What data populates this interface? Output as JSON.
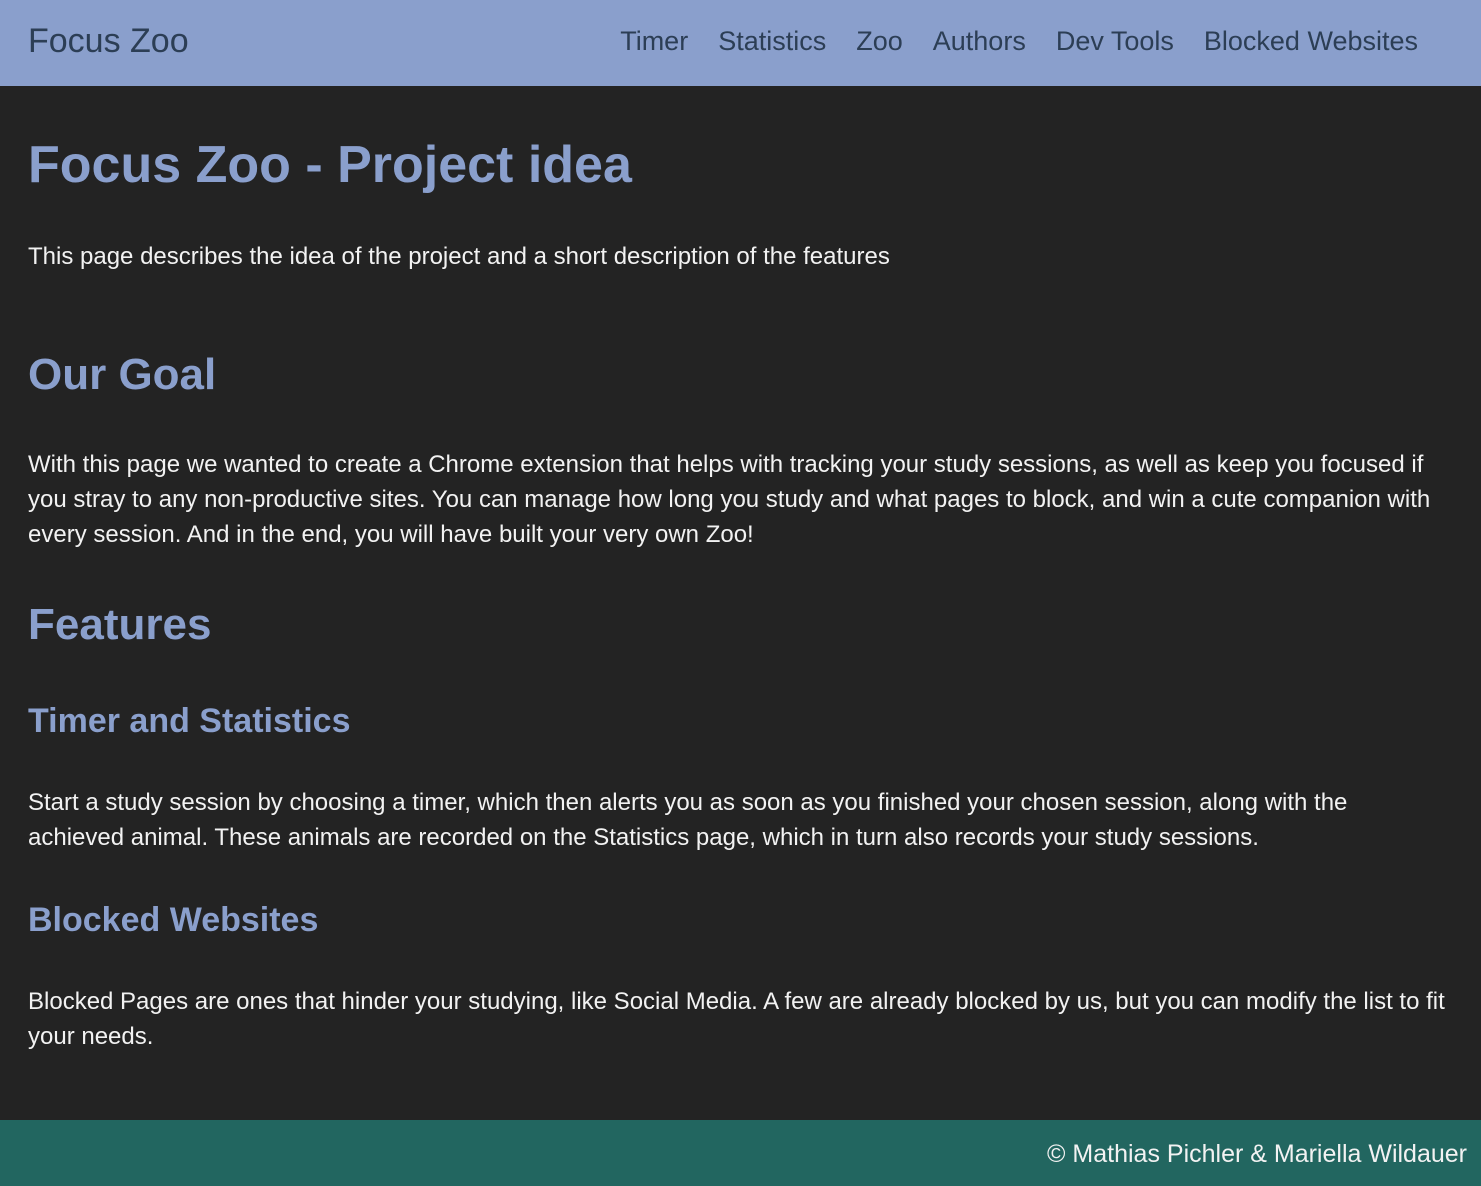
{
  "header": {
    "brand": "Focus Zoo",
    "nav": [
      {
        "label": "Timer"
      },
      {
        "label": "Statistics"
      },
      {
        "label": "Zoo"
      },
      {
        "label": "Authors"
      },
      {
        "label": "Dev Tools"
      },
      {
        "label": "Blocked Websites"
      }
    ]
  },
  "main": {
    "title": "Focus Zoo - Project idea",
    "intro": "This page describes the idea of the project and a short description of the features",
    "goal": {
      "heading": "Our Goal",
      "text": "With this page we wanted to create a Chrome extension that helps with tracking your study sessions, as well as keep you focused if you stray to any non-productive sites. You can manage how long you study and what pages to block, and win a cute companion with every session. And in the end, you will have built your very own Zoo!"
    },
    "features": {
      "heading": "Features",
      "timer": {
        "heading": "Timer and Statistics",
        "text": "Start a study session by choosing a timer, which then alerts you as soon as you finished your chosen session, along with the achieved animal. These animals are recorded on the Statistics page, which in turn also records your study sessions."
      },
      "blocked": {
        "heading": "Blocked Websites",
        "text": "Blocked Pages are ones that hinder your studying, like Social Media. A few are already blocked by us, but you can modify the list to fit your needs."
      }
    }
  },
  "footer": {
    "copyright": "© Mathias Pichler & Mariella Wildauer"
  },
  "colors": {
    "navbar": "#8a9fcc",
    "background": "#232323",
    "heading": "#8a9fcc",
    "footer": "#226660",
    "text": "#f2f2f2"
  }
}
